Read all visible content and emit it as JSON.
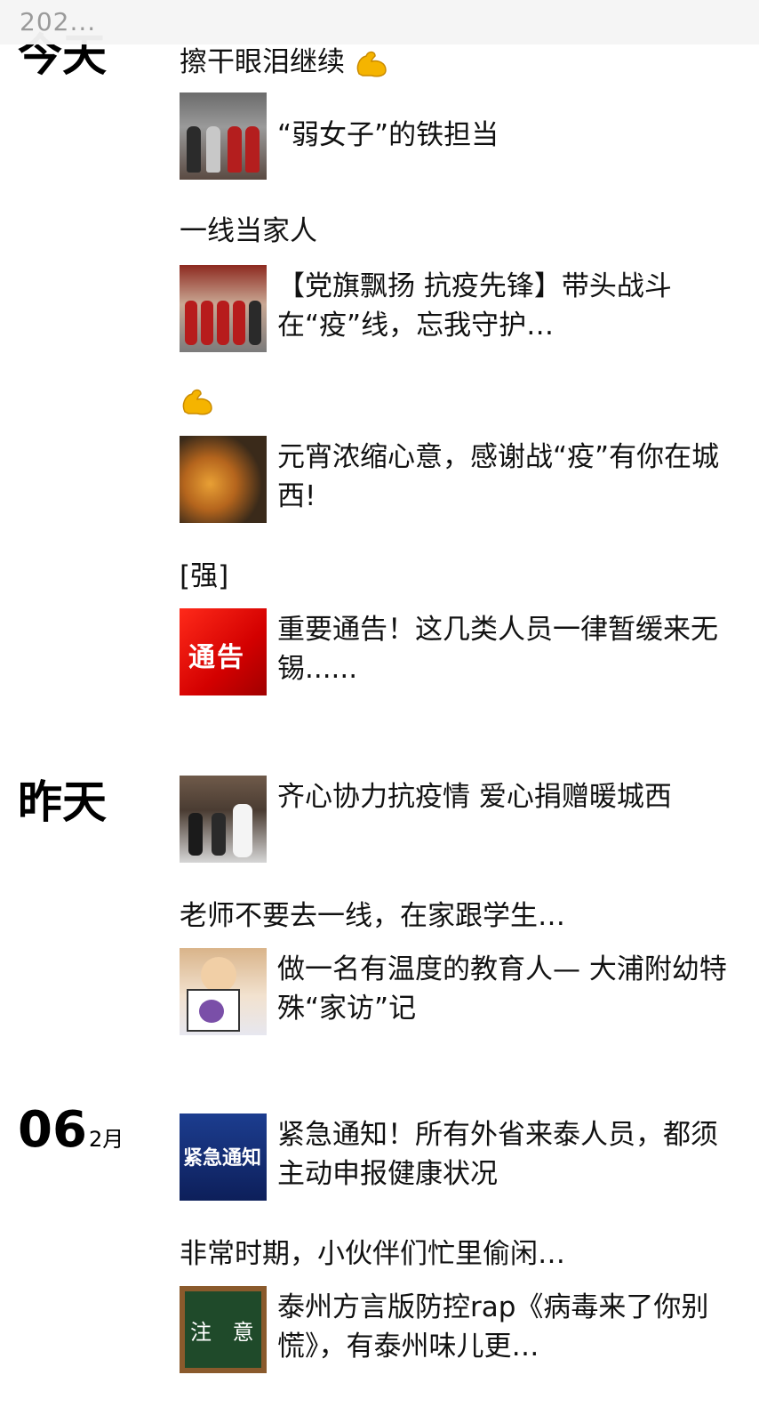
{
  "header": {
    "title": "202..."
  },
  "dates": {
    "today_cut": "今天",
    "yesterday": "昨天",
    "feb06_day": "06",
    "feb06_month": "2月"
  },
  "posts": [
    {
      "text": "擦干眼泪继续",
      "emoji": "flexed-biceps-icon"
    },
    {
      "thumb": "volunteers-table-photo",
      "title": "“弱女子”的铁担当"
    },
    {
      "text": "一线当家人"
    },
    {
      "thumb": "party-volunteers-photo",
      "title": "【党旗飘扬 抗疫先锋】带头战斗在“疫”线，忘我守护…"
    },
    {
      "emoji": "flexed-biceps-icon"
    },
    {
      "thumb": "yuanxiao-food-photo",
      "title": "元宵浓缩心意，感谢战“疫”有你在城西!"
    },
    {
      "text": "[强]"
    },
    {
      "thumb": "notice-thumbnail",
      "thumb_text": "通告",
      "title": "重要通告！这几类人员一律暂缓来无锡......"
    },
    {
      "thumb": "donation-photo",
      "title": "齐心协力抗疫情 爱心捐赠暖城西"
    },
    {
      "text": "老师不要去一线，在家跟学生…"
    },
    {
      "thumb": "child-drawing-photo",
      "title": "做一名有温度的教育人— 大浦附幼特殊“家访”记"
    },
    {
      "thumb": "urgent-notice-thumbnail",
      "thumb_text": "紧急通知",
      "title": "紧急通知！所有外省来泰人员，都须主动申报健康状况"
    },
    {
      "text": "非常时期，小伙伴们忙里偷闲…"
    },
    {
      "thumb": "chalkboard-thumbnail",
      "thumb_text": "注 意",
      "title": "泰州方言版防控rap《病毒来了你别慌》，有泰州味儿更…"
    }
  ],
  "colors": {
    "notice_red": "#d30000",
    "header_bg": "#f5f5f5",
    "emoji_yellow": "#f5b400"
  }
}
